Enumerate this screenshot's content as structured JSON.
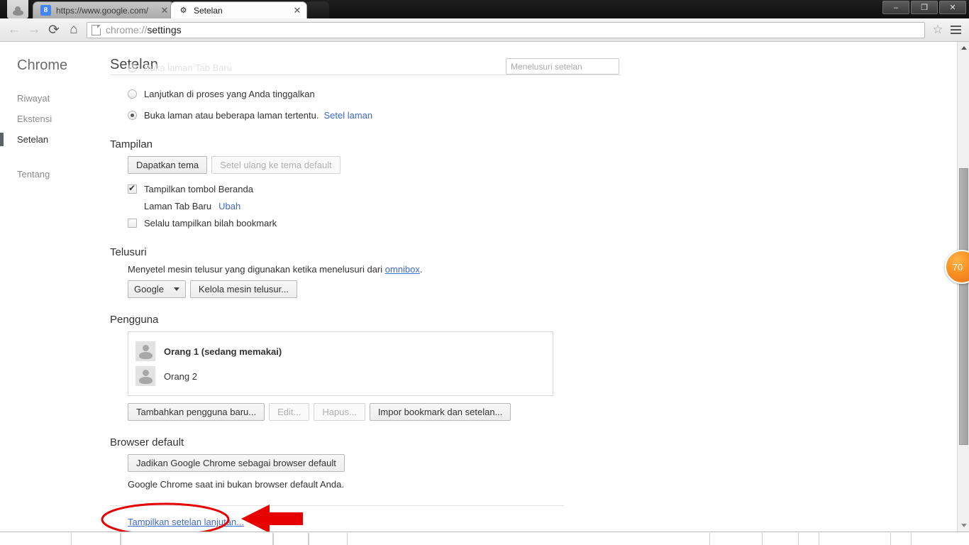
{
  "window": {
    "controls": {
      "minimize": "–",
      "restore": "❐",
      "close": "✕"
    }
  },
  "tabs": [
    {
      "title": "https://www.google.com/",
      "favicon": "google-favicon",
      "favicon_glyph": "8",
      "close": "✕",
      "active": false
    },
    {
      "title": "Setelan",
      "favicon": "gear-icon",
      "favicon_glyph": "⚙",
      "close": "✕",
      "active": true
    }
  ],
  "toolbar": {
    "back": "←",
    "forward": "→",
    "reload": "⟳",
    "home": "⌂",
    "star": "☆",
    "url_scheme": "chrome://",
    "url_path": "settings"
  },
  "sidebar": {
    "title": "Chrome",
    "items": [
      {
        "label": "Riwayat",
        "selected": false
      },
      {
        "label": "Ekstensi",
        "selected": false
      },
      {
        "label": "Setelan",
        "selected": true
      },
      {
        "label": "Tentang",
        "selected": false
      }
    ]
  },
  "main": {
    "title": "Setelan",
    "ghost_option": "Buka laman Tab Baru",
    "search": {
      "value": "",
      "placeholder": "Menelusuri setelan"
    },
    "startup": {
      "options": [
        {
          "label": "Lanjutkan di proses yang Anda tinggalkan",
          "checked": false
        },
        {
          "label": "Buka laman atau beberapa laman tertentu.",
          "checked": true,
          "link": "Setel laman"
        }
      ]
    },
    "appearance": {
      "title": "Tampilan",
      "get_theme": "Dapatkan tema",
      "reset_theme": "Setel ulang ke tema default",
      "show_home_button": {
        "label": "Tampilkan tombol Beranda",
        "checked": true
      },
      "home_page_value": "Laman Tab Baru",
      "home_page_change": "Ubah",
      "show_bookmarks_bar": {
        "label": "Selalu tampilkan bilah bookmark",
        "checked": false
      }
    },
    "search_section": {
      "title": "Telusuri",
      "description_before": "Menyetel mesin telusur yang digunakan ketika menelusuri dari ",
      "description_link": "omnibox",
      "description_after": ".",
      "engine": "Google",
      "manage_button": "Kelola mesin telusur..."
    },
    "users": {
      "title": "Pengguna",
      "list": [
        {
          "name": "Orang 1 (sedang memakai)",
          "current": true
        },
        {
          "name": "Orang 2",
          "current": false
        }
      ],
      "buttons": [
        {
          "label": "Tambahkan pengguna baru...",
          "disabled": false
        },
        {
          "label": "Edit...",
          "disabled": true
        },
        {
          "label": "Hapus...",
          "disabled": true
        },
        {
          "label": "Impor bookmark dan setelan...",
          "disabled": false
        }
      ]
    },
    "default_browser": {
      "title": "Browser default",
      "button": "Jadikan Google Chrome sebagai browser default",
      "status": "Google Chrome saat ini bukan browser default Anda."
    },
    "advanced_link": "Tampilkan setelan lanjutan..."
  },
  "badge": {
    "value": "70",
    "color": "#f79022"
  },
  "annotation": {
    "color": "#e70000",
    "shapes": [
      "ellipse",
      "arrow-left"
    ]
  }
}
